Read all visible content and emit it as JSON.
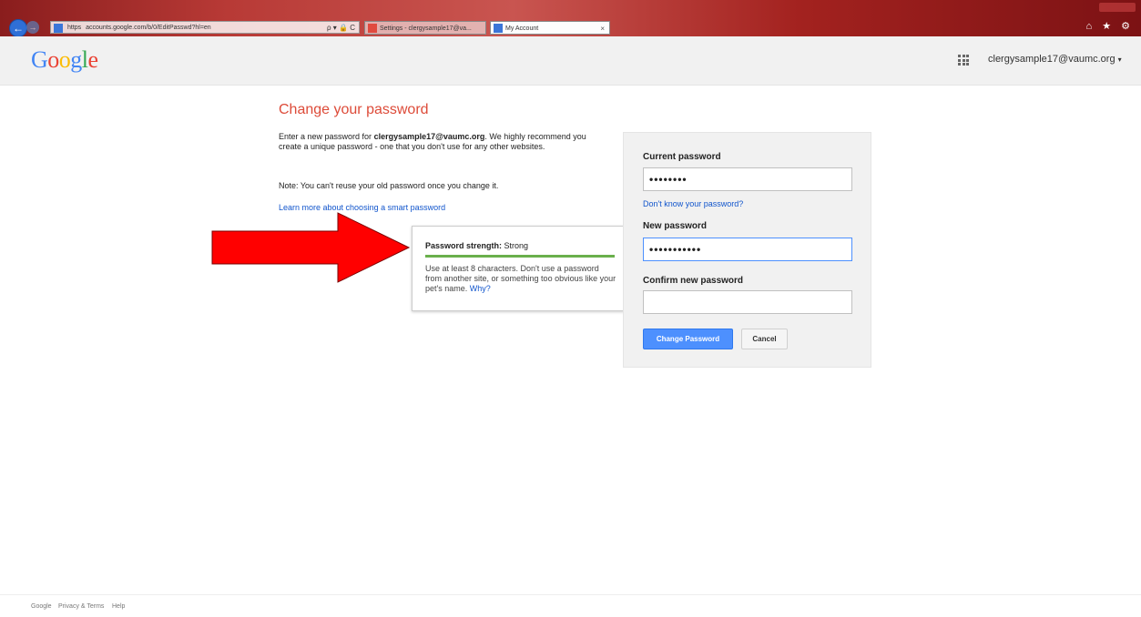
{
  "browser": {
    "address_scheme": "https",
    "address_url": "accounts.google.com/b/0/EditPasswd?hl=en",
    "address_tools": "ρ ▾ 🔒 C",
    "tabs": [
      {
        "label": "Settings - clergysample17@va..."
      },
      {
        "label": "My Account",
        "close": "×"
      }
    ],
    "right_icons": "⌂ ★ ⚙"
  },
  "header": {
    "logo_letters": [
      "G",
      "o",
      "o",
      "g",
      "l",
      "e"
    ],
    "account_email": "clergysample17@vaumc.org",
    "account_caret": "▾"
  },
  "main": {
    "title": "Change your password",
    "intro_prefix": "Enter a new password for ",
    "intro_email": "clergysample17@vaumc.org",
    "intro_suffix": ". We highly recommend you create a unique password - one that you don't use for any other websites.",
    "note": "Note: You can't reuse your old password once you change it.",
    "learn_more": "Learn more about choosing a smart password"
  },
  "strength": {
    "label": "Password strength:",
    "value": "Strong",
    "level": 1.0,
    "bar_color": "#6ab04c",
    "description": "Use at least 8 characters. Don't use a password from another site, or something too obvious like your pet's name.",
    "why": "Why?"
  },
  "form": {
    "current_label": "Current password",
    "current_value": "••••••••",
    "forgot": "Don't know your password?",
    "new_label": "New password",
    "new_value": "•••••••••••",
    "confirm_label": "Confirm new password",
    "confirm_value": "",
    "submit": "Change Password",
    "cancel": "Cancel"
  },
  "footer": {
    "google": "Google",
    "privacy": "Privacy & Terms",
    "help": "Help"
  },
  "colors": {
    "title_red": "#dd4b39",
    "link_blue": "#1155cc",
    "button_blue": "#4d90fe",
    "arrow_red": "#ff0000"
  }
}
